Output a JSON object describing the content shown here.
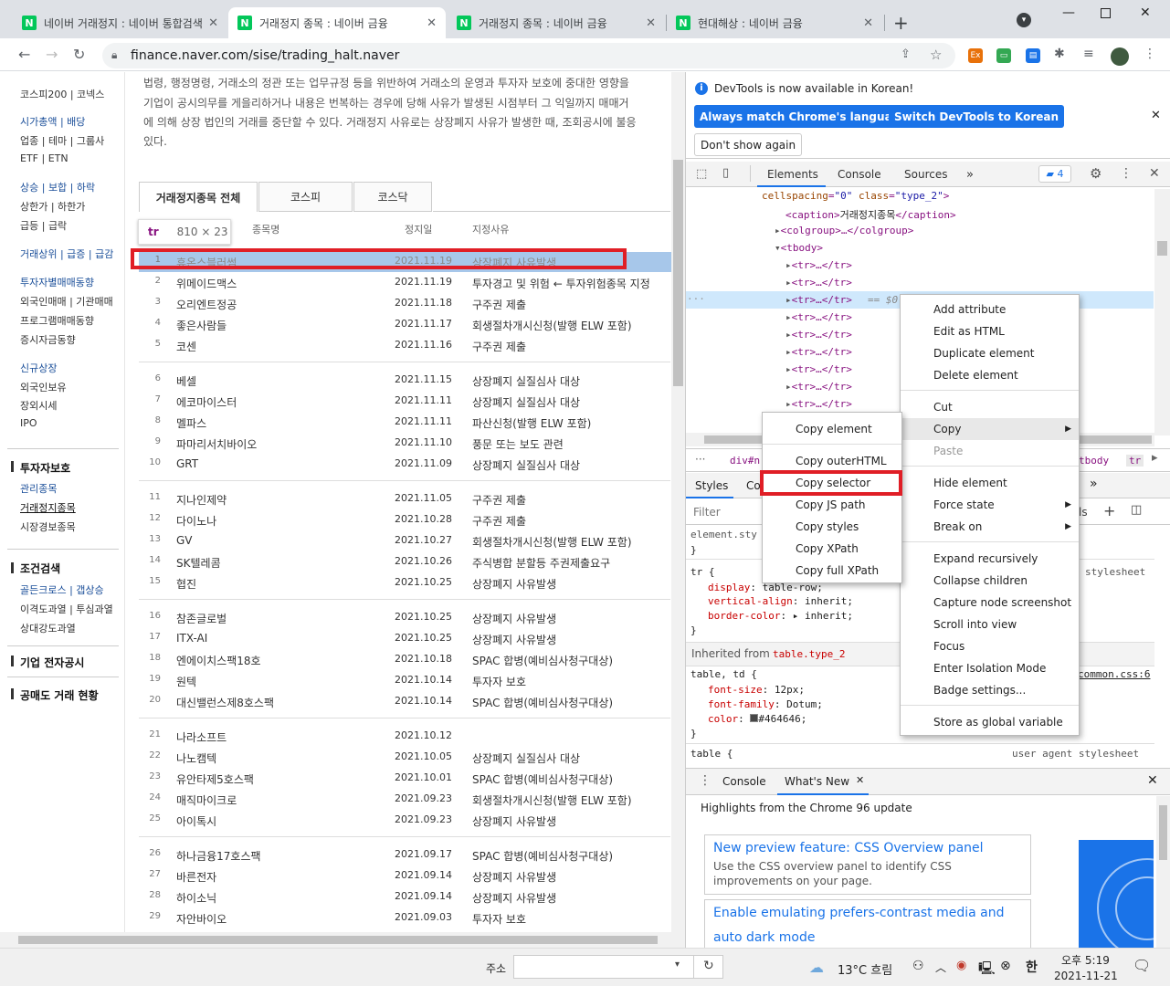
{
  "tabs": [
    {
      "title": "네이버 거래정지 : 네이버 통합검색"
    },
    {
      "title": "거래정지 종목 : 네이버 금융"
    },
    {
      "title": "거래정지 종목 : 네이버 금융"
    },
    {
      "title": "현대해상 : 네이버 금융"
    }
  ],
  "browser": {
    "url": "finance.naver.com/sise/trading_halt.naver"
  },
  "leftnav": {
    "top": "코스피200 | 코넥스",
    "g1": [
      "시가총액 | 배당",
      "업종 | 테마 | 그룹사",
      "ETF | ETN"
    ],
    "g2": [
      "상승 | 보합 | 하락",
      "상한가 | 하한가",
      "급등 | 급락"
    ],
    "g3": [
      "거래상위 | 급증 | 급감"
    ],
    "g4": [
      "투자자별매매동향",
      "외국인매매 | 기관매매",
      "프로그램매매동향",
      "증시자금동향"
    ],
    "g5": [
      "신규상장",
      "외국인보유",
      "장외시세",
      "IPO"
    ],
    "sec1": "투자자보호",
    "sec1items": [
      "관리종목",
      "거래정지종목",
      "시장경보종목"
    ],
    "sec2": "조건검색",
    "sec2items": [
      "골든크로스 | 갭상승",
      "이격도과열 | 투심과열",
      "상대강도과열"
    ],
    "sec3": "기업 전자공시",
    "sec4": "공매도 거래 현황"
  },
  "intro": [
    "법령, 행정명령, 거래소의 정관 또는 업무규정 등을 위반하여 거래소의 운영과 투자자 보호에 중대한 영향을",
    "기업이 공시의무를 게을리하거나 내용은 번복하는 경우에 당해 사유가 발생된 시점부터 그 익일까지 매매거",
    "에 의해 상장 법인의 거래를 중단할 수 있다. 거래정지 사유로는 상장폐지 사유가 발생한 때, 조회공시에 불응",
    "있다."
  ],
  "market_tabs": [
    "거래정지종목 전체",
    "코스피",
    "코스닥"
  ],
  "table_headers": {
    "name": "종목명",
    "date": "정지일",
    "reason": "지정사유"
  },
  "tooltip": {
    "tag": "tr",
    "size": "810 × 23"
  },
  "rows": [
    {
      "n": "1",
      "name": "휴온스블러썸",
      "date": "2021.11.19",
      "reason": "상장폐지 사유발생"
    },
    {
      "n": "2",
      "name": "위메이드맥스",
      "date": "2021.11.19",
      "reason": "투자경고 및 위험 ← 투자위험종목 지정"
    },
    {
      "n": "3",
      "name": "오리엔트정공",
      "date": "2021.11.18",
      "reason": "구주권 제출"
    },
    {
      "n": "4",
      "name": "좋은사람들",
      "date": "2021.11.17",
      "reason": "회생절차개시신청(발행 ELW 포함)"
    },
    {
      "n": "5",
      "name": "코센",
      "date": "2021.11.16",
      "reason": "구주권 제출"
    },
    {
      "n": "6",
      "name": "베셀",
      "date": "2021.11.15",
      "reason": "상장폐지 실질심사 대상"
    },
    {
      "n": "7",
      "name": "에코마이스터",
      "date": "2021.11.11",
      "reason": "상장폐지 실질심사 대상"
    },
    {
      "n": "8",
      "name": "멜파스",
      "date": "2021.11.11",
      "reason": "파산신청(발행 ELW 포함)"
    },
    {
      "n": "9",
      "name": "파마리서치바이오",
      "date": "2021.11.10",
      "reason": "풍문 또는 보도 관련"
    },
    {
      "n": "10",
      "name": "GRT",
      "date": "2021.11.09",
      "reason": "상장폐지 실질심사 대상"
    },
    {
      "n": "11",
      "name": "지나인제약",
      "date": "2021.11.05",
      "reason": "구주권 제출"
    },
    {
      "n": "12",
      "name": "다이노나",
      "date": "2021.10.28",
      "reason": "구주권 제출"
    },
    {
      "n": "13",
      "name": "GV",
      "date": "2021.10.27",
      "reason": "회생절차개시신청(발행 ELW 포함)"
    },
    {
      "n": "14",
      "name": "SK텔레콤",
      "date": "2021.10.26",
      "reason": "주식병합 분할등 주권제출요구"
    },
    {
      "n": "15",
      "name": "협진",
      "date": "2021.10.25",
      "reason": "상장폐지 사유발생"
    },
    {
      "n": "16",
      "name": "참존글로벌",
      "date": "2021.10.25",
      "reason": "상장폐지 사유발생"
    },
    {
      "n": "17",
      "name": "ITX-AI",
      "date": "2021.10.25",
      "reason": "상장폐지 사유발생"
    },
    {
      "n": "18",
      "name": "엔에이치스팩18호",
      "date": "2021.10.18",
      "reason": "SPAC 합병(예비심사청구대상)"
    },
    {
      "n": "19",
      "name": "원텍",
      "date": "2021.10.14",
      "reason": "투자자 보호"
    },
    {
      "n": "20",
      "name": "대신밸런스제8호스팩",
      "date": "2021.10.14",
      "reason": "SPAC 합병(예비심사청구대상)"
    },
    {
      "n": "21",
      "name": "나라소프트",
      "date": "2021.10.12",
      "reason": ""
    },
    {
      "n": "22",
      "name": "나노캠텍",
      "date": "2021.10.05",
      "reason": "상장폐지 실질심사 대상"
    },
    {
      "n": "23",
      "name": "유안타제5호스팩",
      "date": "2021.10.01",
      "reason": "SPAC 합병(예비심사청구대상)"
    },
    {
      "n": "24",
      "name": "매직마이크로",
      "date": "2021.09.23",
      "reason": "회생절차개시신청(발행 ELW 포함)"
    },
    {
      "n": "25",
      "name": "아이톡시",
      "date": "2021.09.23",
      "reason": "상장폐지 사유발생"
    },
    {
      "n": "26",
      "name": "하나금융17호스팩",
      "date": "2021.09.17",
      "reason": "SPAC 합병(예비심사청구대상)"
    },
    {
      "n": "27",
      "name": "바른전자",
      "date": "2021.09.14",
      "reason": "상장폐지 사유발생"
    },
    {
      "n": "28",
      "name": "하이소닉",
      "date": "2021.09.14",
      "reason": "상장폐지 사유발생"
    },
    {
      "n": "29",
      "name": "자안바이오",
      "date": "2021.09.03",
      "reason": "투자자 보호"
    }
  ],
  "devtools": {
    "info": "DevTools is now available in Korean!",
    "btn1": "Always match Chrome's language",
    "btn2": "Switch DevTools to Korean",
    "btn3": "Don't show again",
    "tabs": [
      "Elements",
      "Console",
      "Sources"
    ],
    "badge": "4",
    "dom": {
      "l0a": "cellspacing",
      "l0b": "\"0\"",
      "l0c": "class",
      "l0d": "\"type_2\"",
      "caption_open": "<caption>",
      "caption_text": "거래정지종목",
      "caption_close": "</caption>",
      "colgroup": "<colgroup>…</colgroup>",
      "tbody": "<tbody>",
      "tr": "<tr>…</tr>",
      "sel_suffix": "== $0"
    },
    "crumbs": [
      "div#n",
      "tbody",
      "tr"
    ],
    "styles_tabs": [
      "Styles",
      "Co"
    ],
    "filter_placeholder": "Filter",
    "filter_right": "ls",
    "css": {
      "element": "element.sty",
      "close": "}",
      "tr_sel": "tr {",
      "ua": "stylesheet",
      "d1p": "display",
      "d1v": "table-row;",
      "d2p": "vertical-align",
      "d2v": "inherit;",
      "d3p": "border-color",
      "d3v": "inherit;",
      "inherited_label": "Inherited from",
      "inherited_from": "table.type_2",
      "tdsel": "table, td {",
      "common": "common.css:6",
      "f1p": "font-size",
      "f1v": "12px;",
      "f2p": "font-family",
      "f2v": "Dotum;",
      "f3p": "color",
      "f3v": "#464646;",
      "table_sel": "table {",
      "ua2": "user agent stylesheet"
    },
    "drawer_tabs": [
      "Console",
      "What's New"
    ],
    "whatsnew_title": "Highlights from the Chrome 96 update",
    "card1_title": "New preview feature: CSS Overview panel",
    "card1_body": [
      "Use the CSS overview panel to identify CSS",
      "improvements on your page."
    ],
    "card2_title": [
      "Enable emulating prefers-contrast media and",
      "auto dark mode"
    ]
  },
  "menu_main": {
    "g1": [
      "Add attribute",
      "Edit as HTML",
      "Duplicate element",
      "Delete element"
    ],
    "g2": [
      "Cut",
      "Copy",
      "Paste"
    ],
    "g3": [
      "Hide element",
      "Force state",
      "Break on"
    ],
    "g4": [
      "Expand recursively",
      "Collapse children",
      "Capture node screenshot",
      "Scroll into view",
      "Focus",
      "Enter Isolation Mode",
      "Badge settings..."
    ],
    "g5": [
      "Store as global variable"
    ]
  },
  "menu_copy": {
    "g1": [
      "Copy element"
    ],
    "g2": [
      "Copy outerHTML",
      "Copy selector",
      "Copy JS path",
      "Copy styles",
      "Copy XPath",
      "Copy full XPath"
    ]
  },
  "taskbar": {
    "addr_label": "주소",
    "weather": "13°C 흐림",
    "time": "오후 5:19",
    "date": "2021-11-21",
    "ime": "한"
  },
  "colors": {
    "highlight": "#a7c7ea",
    "annotation": "#e01e26",
    "devtools_blue": "#1a73e8"
  }
}
